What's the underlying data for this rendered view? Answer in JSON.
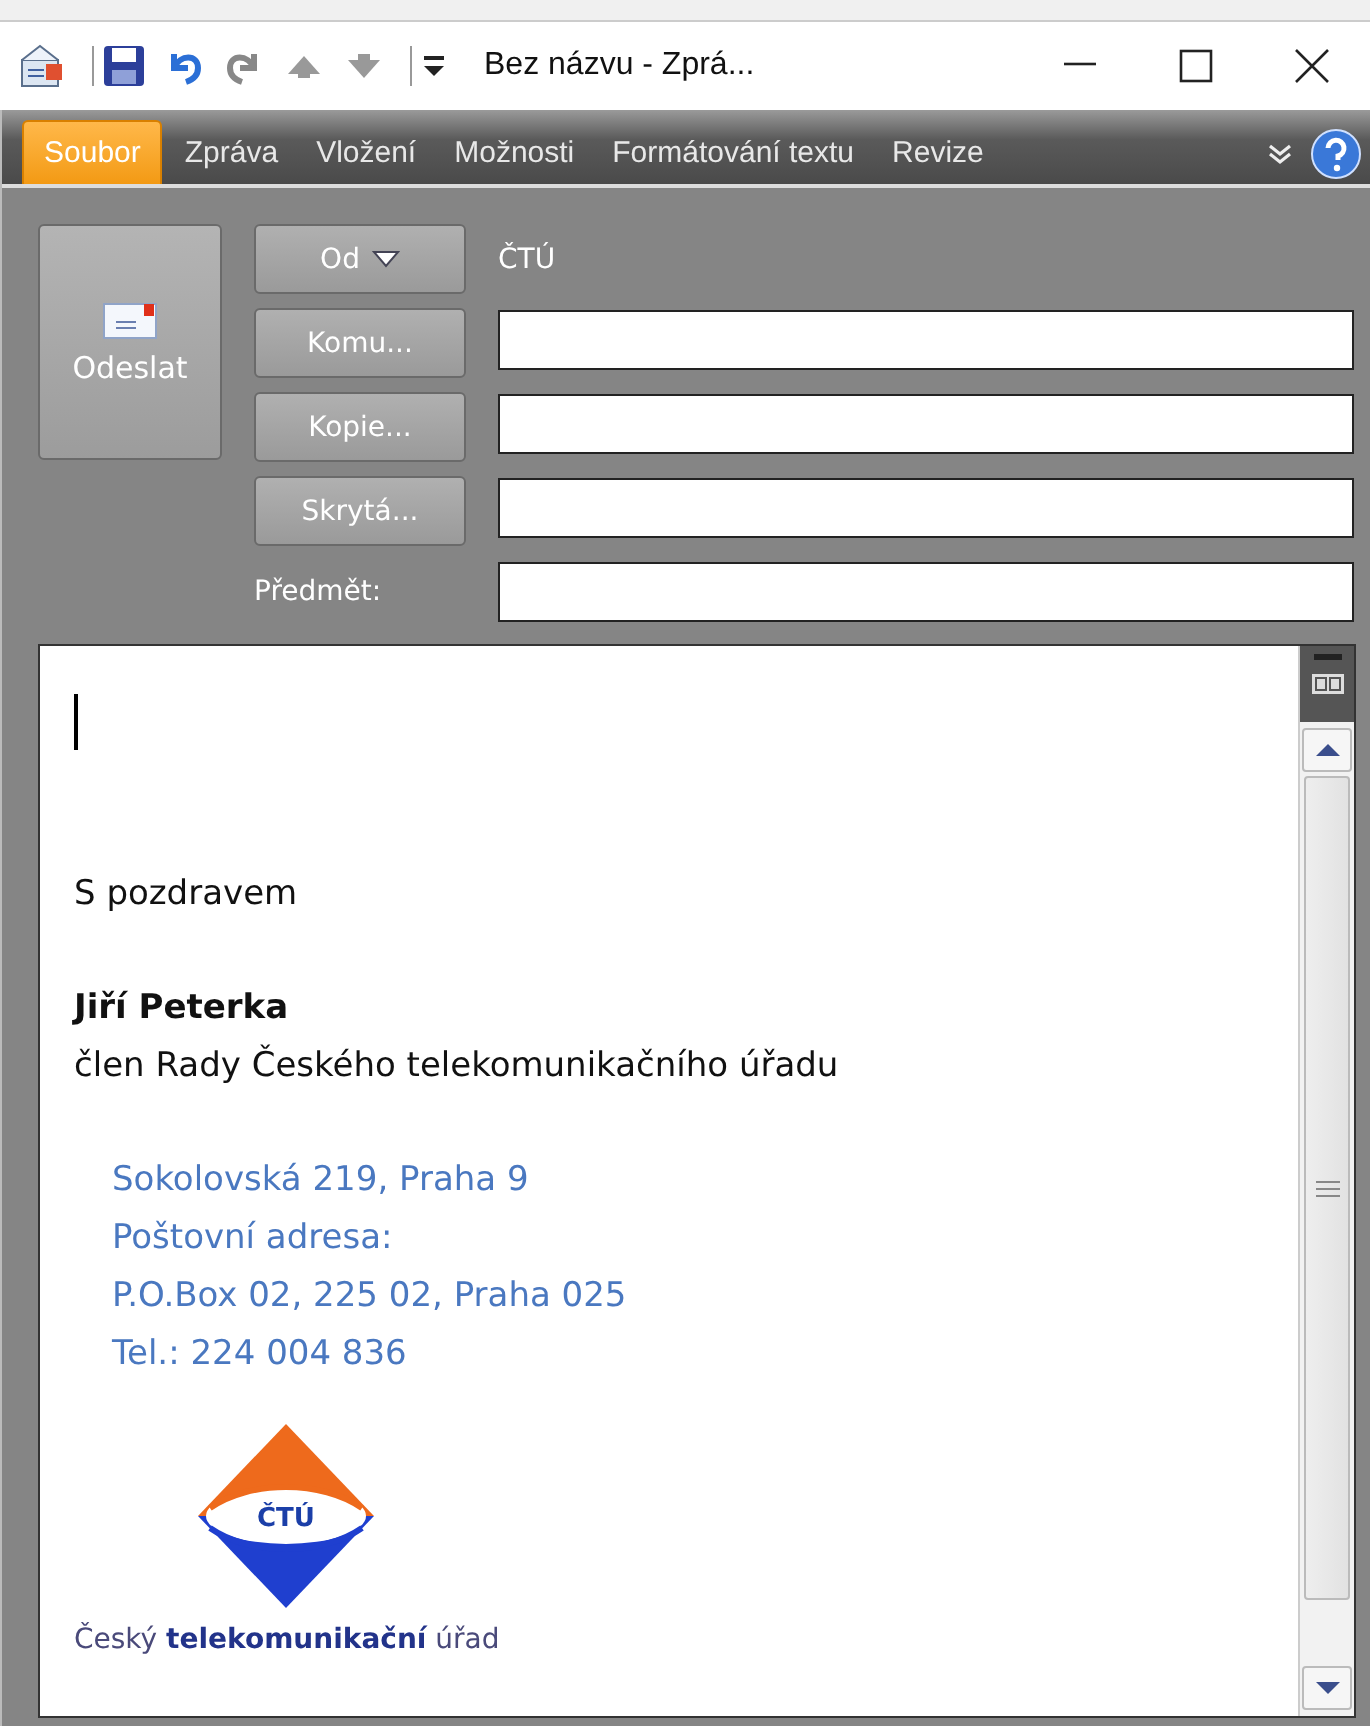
{
  "window": {
    "title": "Bez názvu  -  Zprá..."
  },
  "tabs": [
    {
      "label": "Soubor",
      "selected": true
    },
    {
      "label": "Zpráva",
      "selected": false
    },
    {
      "label": "Vložení",
      "selected": false
    },
    {
      "label": "Možnosti",
      "selected": false
    },
    {
      "label": "Formátování textu",
      "selected": false
    },
    {
      "label": "Revize",
      "selected": false
    }
  ],
  "send_button": {
    "label": "Odeslat"
  },
  "from": {
    "button": "Od",
    "value": "ČTÚ"
  },
  "address_fields": [
    {
      "button": "Komu..."
    },
    {
      "button": "Kopie..."
    },
    {
      "button": "Skrytá..."
    }
  ],
  "subject": {
    "label": "Předmět:"
  },
  "body": {
    "greeting": "S pozdravem",
    "name": "Jiří  Peterka",
    "position": "člen Rady Českého telekomunikačního úřadu",
    "address_lines": [
      "Sokolovská 219, Praha 9",
      "Poštovní adresa:",
      "P.O.Box 02, 225 02, Praha 025",
      "Tel.: 224 004 836"
    ],
    "logo": {
      "abbr": "ČTÚ",
      "name": "Český **telekomunikační** úřad"
    }
  }
}
